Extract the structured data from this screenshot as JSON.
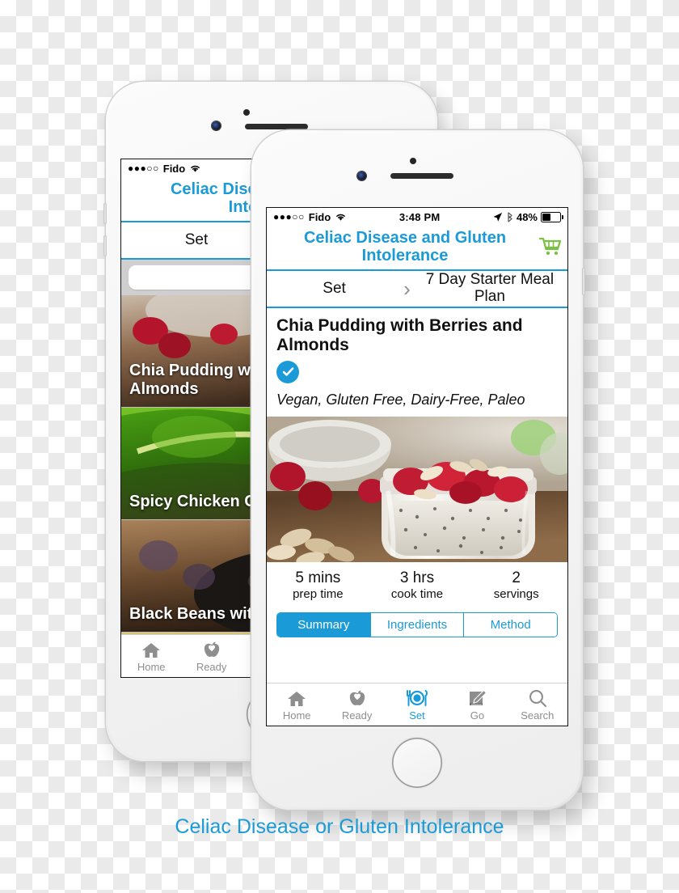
{
  "caption": "Celiac Disease or Gluten Intolerance",
  "colors": {
    "accent_blue": "#1a9bd7",
    "cart_green": "#7ac143",
    "tab_inactive_gray": "#8e8e8e",
    "checkerboard_gray": "#eaeaea"
  },
  "front_phone": {
    "status_bar": {
      "signal_dots": "●●●○○",
      "carrier": "Fido",
      "wifi_icon": "wifi-icon",
      "time": "3:48 PM",
      "location_icon": "location-arrow-icon",
      "bluetooth_icon": "bluetooth-icon",
      "battery_percent": "48%",
      "battery_icon": "battery-icon"
    },
    "navbar": {
      "title": "Celiac Disease and Gluten Intolerance",
      "cart_icon": "shopping-cart-icon"
    },
    "breadcrumb": {
      "parent": "Set",
      "separator_icon": "chevron-right-icon",
      "current": "7 Day Starter Meal Plan"
    },
    "recipe": {
      "title": "Chia Pudding with Berries and Almonds",
      "verified_icon": "check-circle-icon",
      "tags": "Vegan, Gluten Free, Dairy-Free, Paleo",
      "hero_image_alt": "chia-pudding-jar-with-raspberries-and-almonds",
      "stats": [
        {
          "value": "5 mins",
          "label": "prep time"
        },
        {
          "value": "3 hrs",
          "label": "cook time"
        },
        {
          "value": "2",
          "label": "servings"
        }
      ],
      "segments": [
        {
          "label": "Summary",
          "active": true
        },
        {
          "label": "Ingredients",
          "active": false
        },
        {
          "label": "Method",
          "active": false
        }
      ]
    },
    "tabbar": [
      {
        "label": "Home",
        "icon": "home-icon",
        "active": false
      },
      {
        "label": "Ready",
        "icon": "apple-heart-icon",
        "active": false
      },
      {
        "label": "Set",
        "icon": "plate-cutlery-icon",
        "active": true
      },
      {
        "label": "Go",
        "icon": "book-pencil-icon",
        "active": false
      },
      {
        "label": "Search",
        "icon": "magnifier-icon",
        "active": false
      }
    ]
  },
  "rear_phone": {
    "status_bar": {
      "signal_dots": "●●●○○",
      "carrier": "Fido",
      "wifi_icon": "wifi-icon"
    },
    "navbar": {
      "title": "Celiac Disease and Gluten Intolerance"
    },
    "breadcrumb": {
      "parent": "Set"
    },
    "search": {
      "value": "",
      "placeholder": ""
    },
    "cards": [
      {
        "title": "Chia Pudding with Berries and Almonds",
        "image_alt": "chia-pudding-raspberries"
      },
      {
        "title": "Spicy Chicken Caesar Wraps",
        "image_alt": "green-kale-leaf"
      },
      {
        "title": "Black Beans with Rice",
        "image_alt": "black-beans-in-wooden-spoon"
      }
    ],
    "tabbar": [
      {
        "label": "Home",
        "icon": "home-icon",
        "active": false
      },
      {
        "label": "Ready",
        "icon": "apple-heart-icon",
        "active": false
      }
    ]
  }
}
